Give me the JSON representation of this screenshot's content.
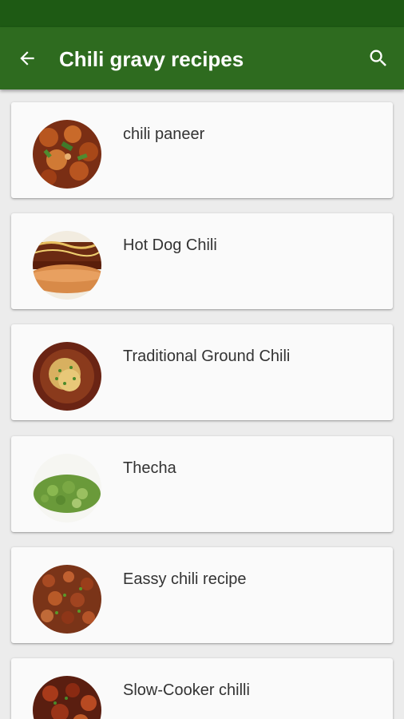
{
  "app_bar": {
    "title": "Chili gravy recipes",
    "back_icon": "arrow-back-icon",
    "search_icon": "search-icon"
  },
  "colors": {
    "status_bar": "#1e5a14",
    "app_bar": "#2e6b1f",
    "card_background": "#fafafa",
    "screen_background": "#ececec"
  },
  "recipes": [
    {
      "title": "chili paneer"
    },
    {
      "title": "Hot Dog Chili"
    },
    {
      "title": "Traditional Ground Chili"
    },
    {
      "title": "Thecha"
    },
    {
      "title": "Eassy chili recipe"
    },
    {
      "title": "Slow-Cooker chilli"
    }
  ]
}
